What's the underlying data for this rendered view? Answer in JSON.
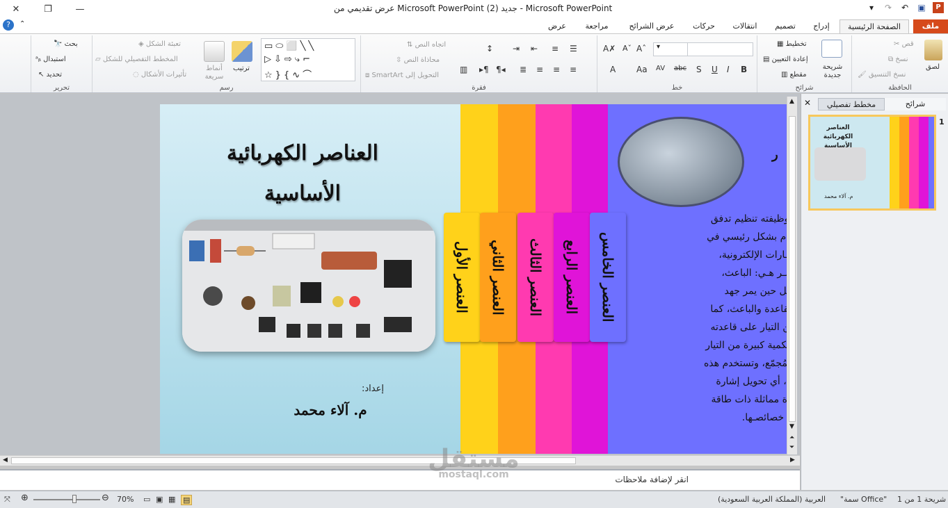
{
  "window": {
    "title": "عرض تقديمي من Microsoft PowerPoint جديد (2) - Microsoft PowerPoint",
    "controls": [
      "close-icon",
      "restore-icon",
      "minimize-icon"
    ]
  },
  "tabs": [
    {
      "label": "ملف",
      "active": false
    },
    {
      "label": "الصفحة الرئيسية",
      "active": true
    },
    {
      "label": "إدراج",
      "active": false
    },
    {
      "label": "تصميم",
      "active": false
    },
    {
      "label": "انتقالات",
      "active": false
    },
    {
      "label": "حركات",
      "active": false
    },
    {
      "label": "عرض الشرائح",
      "active": false
    },
    {
      "label": "مراجعة",
      "active": false
    },
    {
      "label": "عرض",
      "active": false
    }
  ],
  "ribbon": {
    "clipboard": {
      "label": "الحافظة",
      "paste": "لصق",
      "cut": "قص",
      "copy": "نسخ",
      "format_painter": "نسخ التنسيق"
    },
    "slides": {
      "label": "شرائح",
      "new_slide": "شريحة جديدة",
      "layout": "تخطيط",
      "reset": "إعادة التعيين",
      "section": "مقطع"
    },
    "font": {
      "label": "خط"
    },
    "paragraph": {
      "label": "فقرة",
      "text_direction": "اتجاه النص",
      "align_text": "محاذاة النص",
      "smartart": "التحويل إلى SmartArt"
    },
    "drawing": {
      "label": "رسم",
      "arrange": "ترتيب",
      "quick_styles": "أنماط سريعة",
      "fill": "تعبئة الشكل",
      "outline": "المخطط التفصيلي للشكل",
      "effects": "تأثيرات الأشكال"
    },
    "editing": {
      "label": "تحرير",
      "find": "بحث",
      "replace": "استبدال",
      "select": "تحديد"
    }
  },
  "slide": {
    "title_line1": "العناصر الكهربائية",
    "title_line2": "الأساسية",
    "author_label": "إعداد:",
    "author_name": "م. آلاء محمد",
    "tab_labels": [
      "العنصر الأول",
      "العنصر الثاني",
      "العنصر الثالث",
      "العنصر الرابع",
      "العنصر الخامس"
    ],
    "panel_colors": [
      "#ffd21a",
      "#ffa01c",
      "#ff3ab0",
      "#e014d8",
      "#6e70ff"
    ],
    "content_heading": "ر",
    "content_lines": [
      "، جهاز وظيفته تنظيم تدفق",
      "ويُستخدم بشكل رئيسي في",
      "يم الإشـارات الإلكترونية،",
      "ـة عناصـر هـي: الباعث،",
      "ع، ويعمل حين يمر جهد",
      "، بين القاعدة والباعث، كما",
      "قليل من التيار على قاعدته",
      "لتحكم بكمية كبيرة من التيار",
      "عث والمُجمّع، وتستخدم هذه",
      "لتضخيم، أي تحويل إشارة",
      "ى إشارة مماثلة ذات طاقة",
      "يـر مـن خصائصـها."
    ]
  },
  "notes": {
    "text": "انقر لإضافة ملاحظات"
  },
  "pane": {
    "tab_slides": "شرائح",
    "tab_outline": "مخطط تفصيلي",
    "slide_number": "1",
    "thumb_title": "العناصر الكهربائية الأساسية",
    "thumb_author": "م. آلاء محمد"
  },
  "status": {
    "slide_info": "شريحة 1 من 1",
    "theme": "\"سمة Office\"",
    "language": "العربية (المملكة العربية السعودية)",
    "zoom": "70%"
  },
  "watermark": {
    "text1": "مستقل",
    "text2": "mostaql.com"
  }
}
